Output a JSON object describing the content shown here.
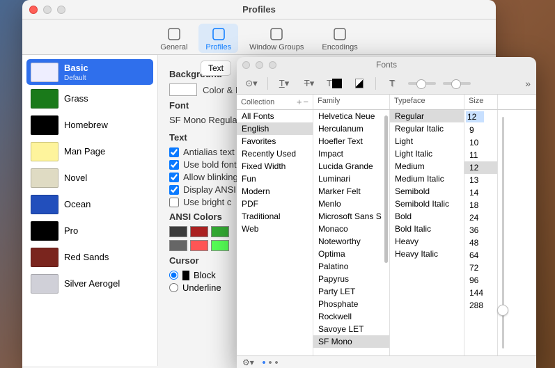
{
  "profiles_window": {
    "title": "Profiles",
    "tabs": [
      {
        "label": "General"
      },
      {
        "label": "Profiles"
      },
      {
        "label": "Window Groups"
      },
      {
        "label": "Encodings"
      }
    ],
    "items": [
      {
        "name": "Basic",
        "sub": "Default",
        "bg": "#eef",
        "selected": true
      },
      {
        "name": "Grass",
        "bg": "#1a7a1a"
      },
      {
        "name": "Homebrew",
        "bg": "#000"
      },
      {
        "name": "Man Page",
        "bg": "#fef49c"
      },
      {
        "name": "Novel",
        "bg": "#dfdbc3"
      },
      {
        "name": "Ocean",
        "bg": "#224fbc"
      },
      {
        "name": "Pro",
        "bg": "#000"
      },
      {
        "name": "Red Sands",
        "bg": "#7a251e"
      },
      {
        "name": "Silver Aerogel",
        "bg": "#d0d0d8"
      }
    ],
    "content": {
      "mini_tab": "Text",
      "background_h": "Background",
      "color_label": "Color & Effects",
      "font_h": "Font",
      "font_value": "SF Mono Regular",
      "text_h": "Text",
      "checks": [
        {
          "label": "Antialias text",
          "checked": true
        },
        {
          "label": "Use bold fonts",
          "checked": true
        },
        {
          "label": "Allow blinking",
          "checked": true
        },
        {
          "label": "Display ANSI",
          "checked": true
        },
        {
          "label": "Use bright c",
          "checked": false
        }
      ],
      "ansi_h": "ANSI Colors",
      "ansi_row1": [
        "#3b3b3b",
        "#a22",
        "#3a3",
        "#a82",
        "#33a",
        "#a3a",
        "#3aa",
        "#ccc"
      ],
      "ansi_row2": [
        "#666",
        "#f55",
        "#5f5",
        "#ff5",
        "#55f",
        "#f5f",
        "#5ff",
        "#fff"
      ],
      "cursor_h": "Cursor",
      "cursor_opts": [
        {
          "label": "Block",
          "checked": true
        },
        {
          "label": "Underline",
          "checked": false
        }
      ]
    }
  },
  "fonts_window": {
    "title": "Fonts",
    "headers": {
      "collection": "Collection",
      "family": "Family",
      "typeface": "Typeface",
      "size": "Size"
    },
    "collections": [
      "All Fonts",
      "English",
      "Favorites",
      "Recently Used",
      "Fixed Width",
      "Fun",
      "Modern",
      "PDF",
      "Traditional",
      "Web"
    ],
    "collections_sel": "English",
    "families": [
      "Helvetica Neue",
      "Herculanum",
      "Hoefler Text",
      "Impact",
      "Lucida Grande",
      "Luminari",
      "Marker Felt",
      "Menlo",
      "Microsoft Sans S",
      "Monaco",
      "Noteworthy",
      "Optima",
      "Palatino",
      "Papyrus",
      "Party LET",
      "Phosphate",
      "Rockwell",
      "Savoye LET",
      "SF Mono"
    ],
    "families_sel": "SF Mono",
    "typefaces": [
      "Regular",
      "Regular Italic",
      "Light",
      "Light Italic",
      "Medium",
      "Medium Italic",
      "Semibold",
      "Semibold Italic",
      "Bold",
      "Bold Italic",
      "Heavy",
      "Heavy Italic"
    ],
    "typefaces_sel": "Regular",
    "size_value": "12",
    "sizes": [
      "9",
      "10",
      "11",
      "12",
      "13",
      "14",
      "18",
      "24",
      "36",
      "48",
      "64",
      "72",
      "96",
      "144",
      "288"
    ],
    "sizes_sel": "12"
  }
}
